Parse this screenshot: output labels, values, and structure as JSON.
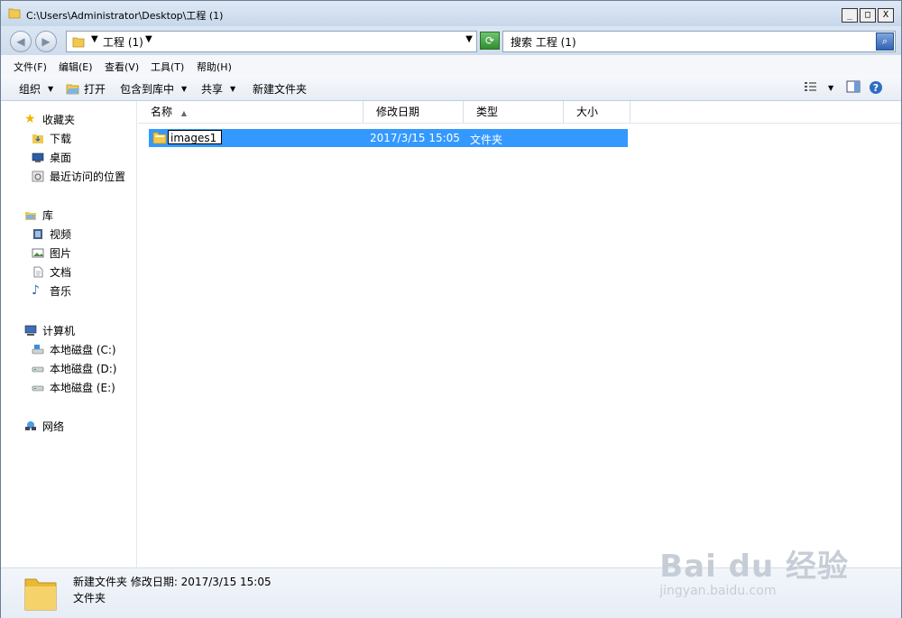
{
  "window": {
    "title": "C:\\Users\\Administrator\\Desktop\\工程 (1)",
    "controls": {
      "minimize": "_",
      "maximize": "□",
      "close": "X"
    }
  },
  "navigation": {
    "back_icon": "back-arrow-icon",
    "forward_icon": "forward-arrow-icon",
    "address": "工程 (1)",
    "search_placeholder": "搜索 工程 (1)"
  },
  "menu": [
    "文件(F)",
    "编辑(E)",
    "查看(V)",
    "工具(T)",
    "帮助(H)"
  ],
  "toolbar": {
    "organize": "组织",
    "open": "打开",
    "include_library": "包含到库中",
    "share": "共享",
    "new_folder": "新建文件夹"
  },
  "sidebar": {
    "favorites": {
      "label": "收藏夹",
      "items": [
        "下载",
        "桌面",
        "最近访问的位置"
      ]
    },
    "libraries": {
      "label": "库",
      "items": [
        "视频",
        "图片",
        "文档",
        "音乐"
      ]
    },
    "computer": {
      "label": "计算机",
      "items": [
        "本地磁盘 (C:)",
        "本地磁盘 (D:)",
        "本地磁盘 (E:)"
      ]
    },
    "network": {
      "label": "网络"
    }
  },
  "columns": [
    "名称",
    "修改日期",
    "类型",
    "大小"
  ],
  "files": [
    {
      "name": "images1",
      "modified": "2017/3/15 15:05",
      "type": "文件夹",
      "size": ""
    }
  ],
  "status": {
    "line1": "新建文件夹  修改日期: 2017/3/15 15:05",
    "line2": "文件夹"
  },
  "watermark": {
    "brand": "Bai du 经验",
    "url": "jingyan.baidu.com"
  },
  "colors": {
    "selection": "#3399ff",
    "folder": "#f2c94c"
  }
}
